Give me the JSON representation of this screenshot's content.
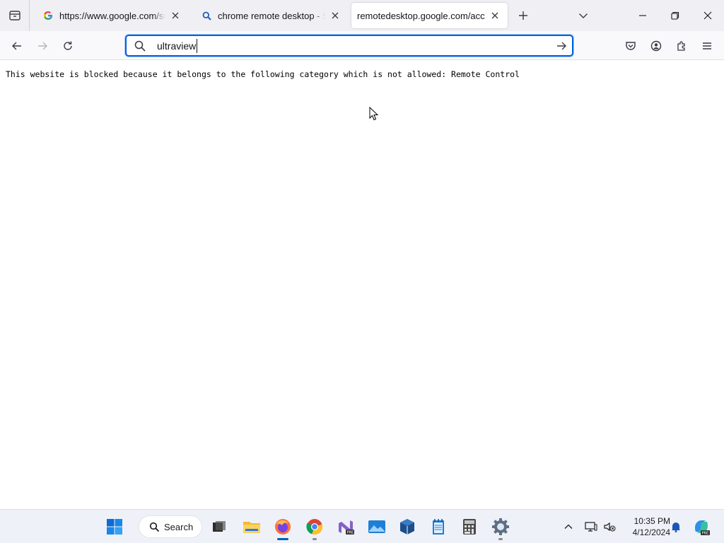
{
  "browser": {
    "tabs": [
      {
        "title": "https://www.google.com/search?q",
        "favicon": "google-g-icon",
        "active": false
      },
      {
        "title": "chrome remote desktop - Search",
        "favicon": "search-icon",
        "active": false
      },
      {
        "title": "remotedesktop.google.com/access",
        "favicon": "",
        "active": true
      }
    ],
    "url_input_value": "ultraview"
  },
  "page": {
    "blocked_message": "This website is blocked because it belongs to the following category which is not allowed: Remote Control"
  },
  "taskbar": {
    "search_label": "Search",
    "time": "10:35 PM",
    "date": "4/12/2024",
    "pinned_apps": [
      "start-menu-icon",
      "task-view-icon",
      "file-explorer-icon",
      "firefox-icon",
      "chrome-icon",
      "visual-studio-preview-icon",
      "photos-icon",
      "virtualbox-icon",
      "notepad-icon",
      "calculator-icon",
      "settings-icon"
    ],
    "tray_icons": [
      "show-hidden-icons-chevron",
      "display-icon",
      "sound-muted-icon",
      "notification-bell-icon",
      "copilot-preview-icon"
    ]
  },
  "colors": {
    "accent": "#0061e0",
    "tabstrip_bg": "#f0f0f4",
    "taskbar_bg": "#eef1f7"
  }
}
